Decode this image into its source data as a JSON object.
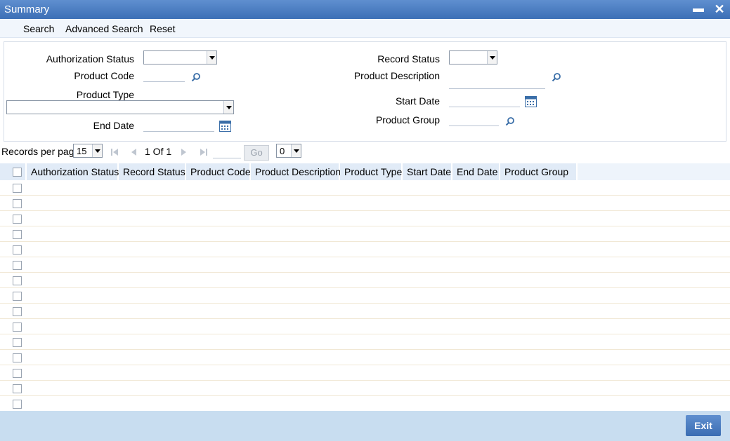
{
  "window": {
    "title": "Summary"
  },
  "toolbar": {
    "search": "Search",
    "advanced_search": "Advanced Search",
    "reset": "Reset"
  },
  "fields": {
    "authorization_status": "Authorization Status",
    "record_status": "Record Status",
    "product_code": "Product Code",
    "product_description": "Product Description",
    "product_type": "Product Type",
    "start_date": "Start Date",
    "end_date": "End Date",
    "product_group": "Product Group"
  },
  "pager": {
    "records_per_page_label": "Records per page",
    "records_per_page_value": "15",
    "page_info": "1 Of 1",
    "go_label": "Go",
    "extra_value": "0"
  },
  "grid": {
    "columns": [
      "Authorization Status",
      "Record Status",
      "Product Code",
      "Product Description",
      "Product Type",
      "Start Date",
      "End Date",
      "Product Group"
    ]
  },
  "footer": {
    "exit_label": "Exit"
  },
  "colors": {
    "accent": "#3c6fb6",
    "footer_bg": "#c8ddf0"
  }
}
